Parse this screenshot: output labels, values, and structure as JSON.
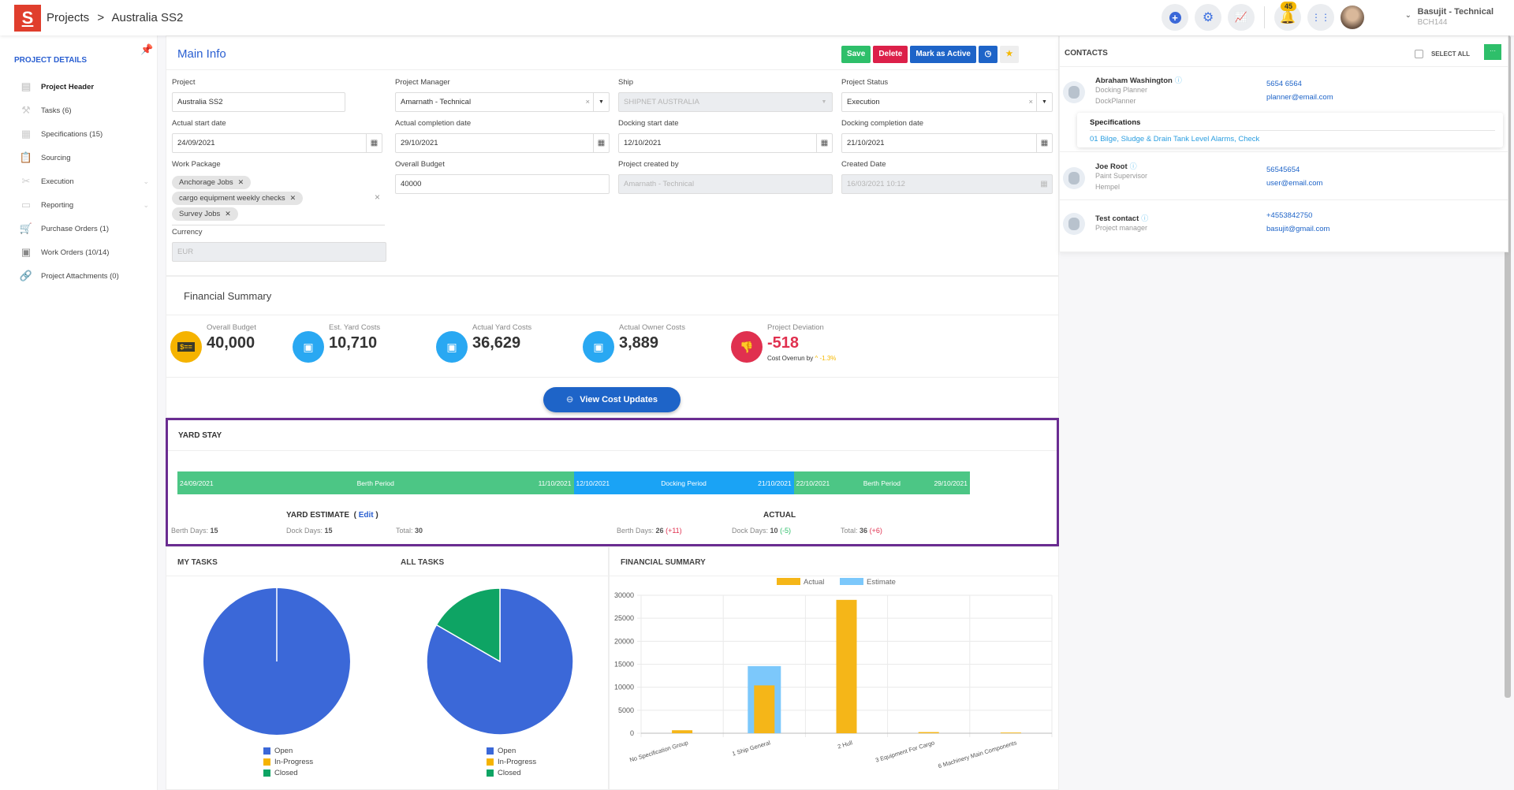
{
  "header": {
    "logo_letter": "S",
    "breadcrumb": [
      "Projects",
      ">",
      "Australia SS2"
    ],
    "notification_count": "45",
    "user_name": "Basujit - Technical",
    "user_code": "BCH144",
    "icons": [
      "plus-circle-icon",
      "gear-icon",
      "chart-icon",
      "bell-icon",
      "apps-grid-icon"
    ]
  },
  "sidebar": {
    "title": "PROJECT DETAILS",
    "items": [
      {
        "label": "Project Header",
        "icon": "document-icon",
        "active": true
      },
      {
        "label": "Tasks (6)",
        "icon": "hammer-icon"
      },
      {
        "label": "Specifications (15)",
        "icon": "spec-icon"
      },
      {
        "label": "Sourcing",
        "icon": "clipboard-icon"
      },
      {
        "label": "Execution",
        "icon": "tools-icon",
        "expandable": true
      },
      {
        "label": "Reporting",
        "icon": "presentation-icon",
        "expandable": true
      },
      {
        "label": "Purchase Orders (1)",
        "icon": "cart-icon"
      },
      {
        "label": "Work Orders (10/14)",
        "icon": "work-order-icon"
      },
      {
        "label": "Project Attachments (0)",
        "icon": "link-icon"
      }
    ]
  },
  "main_info": {
    "title": "Main Info",
    "actions": {
      "save": "Save",
      "delete": "Delete",
      "mark_active": "Mark as Active"
    },
    "fields": {
      "project": {
        "label": "Project",
        "value": "Australia SS2"
      },
      "project_manager": {
        "label": "Project Manager",
        "value": "Amarnath - Technical"
      },
      "ship": {
        "label": "Ship",
        "value": "SHIPNET AUSTRALIA"
      },
      "project_status": {
        "label": "Project Status",
        "value": "Execution"
      },
      "actual_start": {
        "label": "Actual start date",
        "value": "24/09/2021"
      },
      "actual_completion": {
        "label": "Actual completion date",
        "value": "29/10/2021"
      },
      "docking_start": {
        "label": "Docking start date",
        "value": "12/10/2021"
      },
      "docking_completion": {
        "label": "Docking completion date",
        "value": "21/10/2021"
      },
      "work_package": {
        "label": "Work Package",
        "chips": [
          "Anchorage Jobs",
          "cargo equipment weekly checks",
          "Survey Jobs"
        ]
      },
      "overall_budget": {
        "label": "Overall Budget",
        "value": "40000"
      },
      "created_by": {
        "label": "Project created by",
        "value": "Amarnath - Technical"
      },
      "created_date": {
        "label": "Created Date",
        "value": "16/03/2021 10:12"
      },
      "currency": {
        "label": "Currency",
        "value": "EUR"
      }
    }
  },
  "financial_summary": {
    "title": "Financial Summary",
    "kpis": [
      {
        "label": "Overall Budget",
        "value": "40,000",
        "color": "#f5b300",
        "icon": "money-bill-icon"
      },
      {
        "label": "Est. Yard Costs",
        "value": "10,710",
        "color": "#29a8f2",
        "icon": "cash-icon"
      },
      {
        "label": "Actual Yard Costs",
        "value": "36,629",
        "color": "#29a8f2",
        "icon": "cash-icon"
      },
      {
        "label": "Actual Owner Costs",
        "value": "3,889",
        "color": "#29a8f2",
        "icon": "cash-icon"
      },
      {
        "label": "Project Deviation",
        "value": "-518",
        "color": "#e0304f",
        "icon": "thumbs-down-icon",
        "sub_label": "Cost Overrun by",
        "sub_value": "-1.3%"
      }
    ],
    "view_button": "View Cost Updates"
  },
  "yard_stay": {
    "title": "YARD STAY",
    "timeline": [
      {
        "start": "24/09/2021",
        "label": "Berth Period",
        "end": "11/10/2021",
        "color": "#4cc685",
        "days": 18
      },
      {
        "start": "12/10/2021",
        "label": "Docking Period",
        "end": "21/10/2021",
        "color": "#1aa3f5",
        "days": 10
      },
      {
        "start": "22/10/2021",
        "label": "Berth Period",
        "end": "29/10/2021",
        "color": "#4cc685",
        "days": 8
      }
    ],
    "estimate": {
      "title": "YARD ESTIMATE",
      "edit": "Edit",
      "berth_label": "Berth Days:",
      "berth": "15",
      "dock_label": "Dock Days:",
      "dock": "15",
      "total_label": "Total:",
      "total": "30"
    },
    "actual": {
      "title": "ACTUAL",
      "berth_label": "Berth Days:",
      "berth": "26",
      "berth_diff": "(+11)",
      "dock_label": "Dock Days:",
      "dock": "10",
      "dock_diff": "(-5)",
      "total_label": "Total:",
      "total": "36",
      "total_diff": "(+6)"
    }
  },
  "tasks": {
    "my_tasks_title": "MY TASKS",
    "all_tasks_title": "ALL TASKS",
    "legend": [
      "Open",
      "In-Progress",
      "Closed"
    ],
    "colors": {
      "Open": "#3b68d8",
      "In-Progress": "#f5b300",
      "Closed": "#0ea464"
    }
  },
  "financial_chart_title": "FINANCIAL SUMMARY",
  "chart_data": [
    {
      "type": "pie",
      "title": "MY TASKS",
      "categories": [
        "Open",
        "In-Progress",
        "Closed"
      ],
      "values": [
        1,
        0,
        0
      ]
    },
    {
      "type": "pie",
      "title": "ALL TASKS",
      "categories": [
        "Open",
        "In-Progress",
        "Closed"
      ],
      "values": [
        5,
        0,
        1
      ]
    },
    {
      "type": "bar",
      "title": "FINANCIAL SUMMARY",
      "categories": [
        "No Specification Group",
        "1 Ship General",
        "2 Hull",
        "3 Equipment For Cargo",
        "6 Machinery Main Components"
      ],
      "series": [
        {
          "name": "Actual",
          "color": "#f5b618",
          "values": [
            650,
            10400,
            29000,
            250,
            150
          ]
        },
        {
          "name": "Estimate",
          "color": "#7cc8fb",
          "values": [
            0,
            14600,
            0,
            0,
            0
          ]
        }
      ],
      "yticks": [
        0,
        5000,
        10000,
        15000,
        20000,
        25000,
        30000
      ],
      "ylim": [
        0,
        30000
      ],
      "legend": "top",
      "grid": true
    }
  ],
  "contacts": {
    "title": "CONTACTS",
    "select_all": "SELECT ALL",
    "more": "···",
    "list": [
      {
        "name": "Abraham Washington",
        "role": "Docking Planner",
        "company": "DockPlanner",
        "phone": "5654 6564",
        "email": "planner@email.com"
      },
      {
        "name": "Joe Root",
        "role": "Paint Supervisor",
        "company": "Hempel",
        "phone": "56545654",
        "email": "user@email.com"
      },
      {
        "name": "Test contact",
        "role": "Project manager",
        "company": "",
        "phone": "+4553842750",
        "email": "basujit@gmail.com"
      }
    ],
    "spec_popup": {
      "title": "Specifications",
      "link": "01 Bilge, Sludge & Drain Tank Level Alarms, Check"
    }
  }
}
